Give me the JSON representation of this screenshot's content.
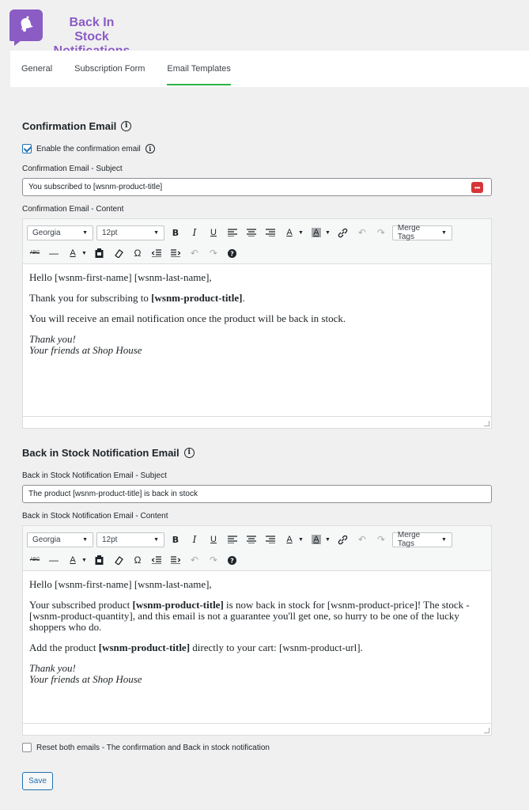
{
  "brand": {
    "title_line1": "Back In Stock",
    "title_line2": "Notifications"
  },
  "tabs": [
    {
      "label": "General"
    },
    {
      "label": "Subscription Form"
    },
    {
      "label": "Email Templates",
      "active": true
    }
  ],
  "confirmation": {
    "title": "Confirmation Email",
    "enable_label": "Enable the confirmation email",
    "enable_checked": true,
    "subject_label": "Confirmation Email - Subject",
    "subject_value": "You subscribed to [wsnm-product-title]",
    "content_label": "Confirmation Email - Content",
    "editor": {
      "font": "Georgia",
      "size": "12pt",
      "merge_tags": "Merge Tags",
      "p1": "Hello [wsnm-first-name] [wsnm-last-name],",
      "p2_pre": "Thank you for subscribing to ",
      "p2_bold": "[wsnm-product-title]",
      "p2_post": ".",
      "p3": "You will receive an email notification once the product will be back in stock.",
      "sign1": "Thank you!",
      "sign2": "Your friends at Shop House"
    }
  },
  "backinstock": {
    "title": "Back in Stock Notification Email",
    "subject_label": "Back in Stock Notification Email - Subject",
    "subject_value": "The product [wsnm-product-title] is back in stock",
    "content_label": "Back in Stock Notification Email - Content",
    "editor": {
      "font": "Georgia",
      "size": "12pt",
      "merge_tags": "Merge Tags",
      "p1": "Hello [wsnm-first-name] [wsnm-last-name],",
      "p2_pre": "Your subscribed product ",
      "p2_bold": "[wsnm-product-title]",
      "p2_post": " is now back in stock for [wsnm-product-price]! The stock - [wsnm-product-quantity], and this email is not a guarantee you'll get one, so hurry to be one of the lucky shoppers who do.",
      "p3_pre": "Add the product ",
      "p3_bold": "[wsnm-product-title]",
      "p3_post": " directly to your cart: [wsnm-product-url].",
      "sign1": "Thank you!",
      "sign2": "Your friends at Shop House"
    }
  },
  "reset_label": "Reset both emails - The confirmation and Back in stock notification",
  "reset_checked": false,
  "save_label": "Save",
  "colors": {
    "brand": "#8a5cc4",
    "tab_active_underline": "#2fb344",
    "primary": "#2271b1",
    "merge_tag_button": "#d63638"
  }
}
